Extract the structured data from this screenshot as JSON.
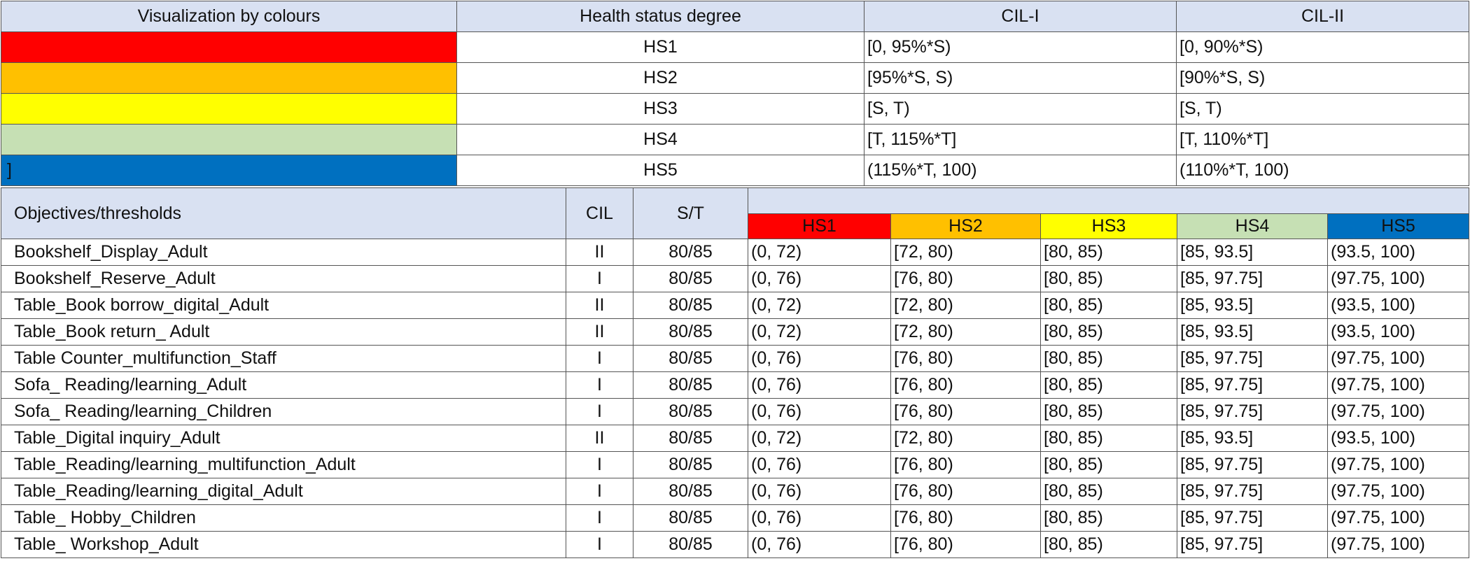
{
  "legend_table": {
    "headers": [
      "Visualization by colours",
      "Health status degree",
      "CIL-I",
      "CIL-II"
    ],
    "rows": [
      {
        "color": "#ff0000",
        "swatch_text": "",
        "hs": "HS1",
        "cil1": "[0, 95%*S)",
        "cil2": "[0, 90%*S)"
      },
      {
        "color": "#ffc000",
        "swatch_text": "",
        "hs": "HS2",
        "cil1": "[95%*S, S)",
        "cil2": "[90%*S, S)"
      },
      {
        "color": "#ffff00",
        "swatch_text": "",
        "hs": "HS3",
        "cil1": "[S, T)",
        "cil2": "[S, T)"
      },
      {
        "color": "#c6e0b4",
        "swatch_text": "",
        "hs": "HS4",
        "cil1": "[T, 115%*T]",
        "cil2": "[T, 110%*T]"
      },
      {
        "color": "#0070c0",
        "swatch_text": "]",
        "hs": "HS5",
        "cil1": "(115%*T,  100)",
        "cil2": "(110%*T,  100)"
      }
    ]
  },
  "threshold_table": {
    "headers": {
      "objectives": "Objectives/thresholds",
      "cil": "CIL",
      "st": "S/T",
      "hs": [
        {
          "label": "HS1",
          "color": "#ff0000"
        },
        {
          "label": "HS2",
          "color": "#ffc000"
        },
        {
          "label": "HS3",
          "color": "#ffff00"
        },
        {
          "label": "HS4",
          "color": "#c6e0b4"
        },
        {
          "label": "HS5",
          "color": "#0070c0"
        }
      ]
    },
    "rows": [
      {
        "name": "Bookshelf_Display_Adult",
        "cil": "II",
        "st": "80/85",
        "hs1": "(0, 72)",
        "hs2": "[72, 80)",
        "hs3": "[80, 85)",
        "hs4": "[85, 93.5]",
        "hs5": "(93.5,  100)"
      },
      {
        "name": "Bookshelf_Reserve_Adult",
        "cil": "I",
        "st": "80/85",
        "hs1": "(0, 76)",
        "hs2": "[76, 80)",
        "hs3": "[80, 85)",
        "hs4": "[85, 97.75]",
        "hs5": "(97.75, 100)"
      },
      {
        "name": "Table_Book borrow_digital_Adult",
        "cil": "II",
        "st": "80/85",
        "hs1": "(0, 72)",
        "hs2": "[72, 80)",
        "hs3": "[80, 85)",
        "hs4": "[85, 93.5]",
        "hs5": "(93.5,  100)"
      },
      {
        "name": "Table_Book return_ Adult",
        "cil": "II",
        "st": "80/85",
        "hs1": "(0, 72)",
        "hs2": "[72, 80)",
        "hs3": "[80, 85)",
        "hs4": "[85, 93.5]",
        "hs5": "(93.5,  100)"
      },
      {
        "name": "Table Counter_multifunction_Staff",
        "cil": "I",
        "st": "80/85",
        "hs1": "(0, 76)",
        "hs2": "[76, 80)",
        "hs3": "[80, 85)",
        "hs4": "[85, 97.75]",
        "hs5": "(97.75, 100)"
      },
      {
        "name": "Sofa_ Reading/learning_Adult",
        "cil": "I",
        "st": "80/85",
        "hs1": "(0, 76)",
        "hs2": "[76, 80)",
        "hs3": "[80, 85)",
        "hs4": "[85, 97.75]",
        "hs5": "(97.75, 100)"
      },
      {
        "name": "Sofa_ Reading/learning_Children",
        "cil": "I",
        "st": "80/85",
        "hs1": "(0, 76)",
        "hs2": "[76, 80)",
        "hs3": "[80, 85)",
        "hs4": "[85, 97.75]",
        "hs5": "(97.75, 100)"
      },
      {
        "name": "Table_Digital inquiry_Adult",
        "cil": "II",
        "st": "80/85",
        "hs1": "(0, 72)",
        "hs2": "[72, 80)",
        "hs3": "[80, 85)",
        "hs4": "[85, 93.5]",
        "hs5": "(93.5,  100)"
      },
      {
        "name": "Table_Reading/learning_multifunction_Adult",
        "cil": "I",
        "st": "80/85",
        "hs1": "(0, 76)",
        "hs2": "[76, 80)",
        "hs3": "[80, 85)",
        "hs4": "[85, 97.75]",
        "hs5": "(97.75, 100)"
      },
      {
        "name": "Table_Reading/learning_digital_Adult",
        "cil": "I",
        "st": "80/85",
        "hs1": "(0, 76)",
        "hs2": "[76, 80)",
        "hs3": "[80, 85)",
        "hs4": "[85, 97.75]",
        "hs5": "(97.75, 100)"
      },
      {
        "name": "Table_ Hobby_Children",
        "cil": "I",
        "st": "80/85",
        "hs1": "(0, 76)",
        "hs2": "[76, 80)",
        "hs3": "[80, 85)",
        "hs4": "[85, 97.75]",
        "hs5": "(97.75, 100)"
      },
      {
        "name": "Table_ Workshop_Adult",
        "cil": "I",
        "st": "80/85",
        "hs1": "(0, 76)",
        "hs2": "[76, 80)",
        "hs3": "[80, 85)",
        "hs4": "[85, 97.75]",
        "hs5": "(97.75, 100)"
      }
    ]
  }
}
